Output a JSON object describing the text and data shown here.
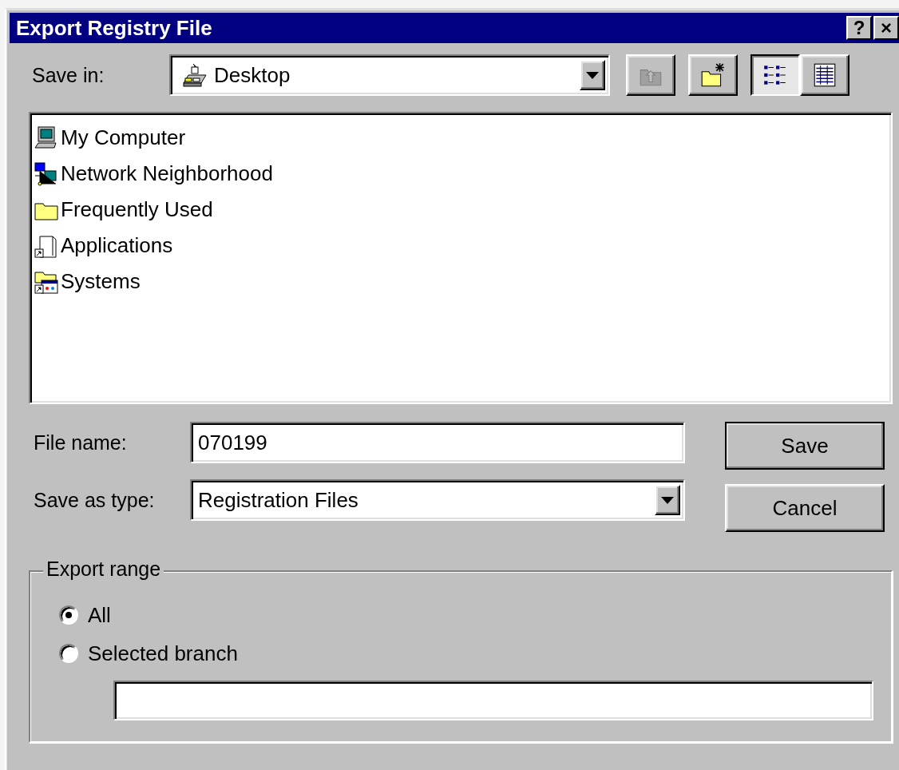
{
  "window": {
    "title": "Export Registry File",
    "help_button": "?",
    "close_button": "×"
  },
  "save_in": {
    "label": "Save in:",
    "value": "Desktop",
    "kind": "desktop"
  },
  "toolbar": [
    {
      "kind": "up-folder",
      "disabled": true,
      "selected": false
    },
    {
      "kind": "new-folder",
      "disabled": false,
      "selected": false
    },
    {
      "kind": "list-view",
      "selected": true
    },
    {
      "kind": "details-view",
      "selected": false
    }
  ],
  "files": [
    {
      "name": "My Computer",
      "kind": "computer",
      "selected": false
    },
    {
      "name": "Network Neighborhood",
      "kind": "network",
      "selected": false
    },
    {
      "name": "Frequently Used",
      "kind": "folder",
      "selected": false
    },
    {
      "name": "Applications",
      "kind": "applications",
      "selected": false
    },
    {
      "name": "Systems",
      "kind": "systems",
      "selected": false
    }
  ],
  "file_name": {
    "label": "File name:",
    "value": "070199"
  },
  "save_as_type": {
    "label": "Save as type:",
    "value": "Registration Files"
  },
  "buttons": [
    {
      "label": "Save",
      "default": true
    },
    {
      "label": "Cancel",
      "default": false
    }
  ],
  "export_range": {
    "title": "Export range",
    "options": [
      {
        "label": "All",
        "selected": true
      },
      {
        "label": "Selected branch",
        "selected": false
      }
    ]
  }
}
